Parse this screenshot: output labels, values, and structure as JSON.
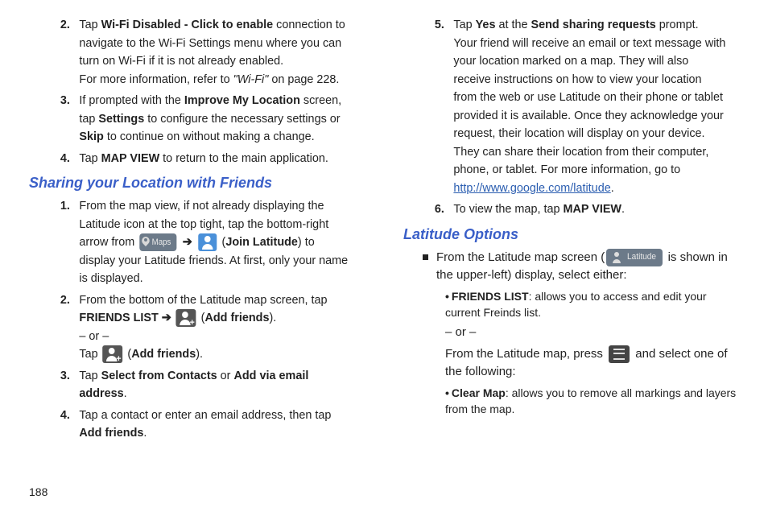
{
  "page_number": "188",
  "left": {
    "items_top": [
      {
        "num": "2.",
        "parts": [
          {
            "t": "Tap "
          },
          {
            "t": "Wi-Fi Disabled - Click to enable",
            "b": true
          },
          {
            "t": " connection to navigate to the Wi-Fi Settings menu where you can turn on Wi-Fi if it is not already enabled."
          },
          {
            "br": true
          },
          {
            "t": "For more information, refer to "
          },
          {
            "t": "\"Wi-Fi\"",
            "i": true
          },
          {
            "t": "  on page 228."
          }
        ]
      },
      {
        "num": "3.",
        "parts": [
          {
            "t": "If prompted with the "
          },
          {
            "t": "Improve My Location",
            "b": true
          },
          {
            "t": " screen, tap "
          },
          {
            "t": "Settings",
            "b": true
          },
          {
            "t": " to configure the necessary settings or "
          },
          {
            "t": "Skip",
            "b": true
          },
          {
            "t": " to continue on without making a change."
          }
        ]
      },
      {
        "num": "4.",
        "parts": [
          {
            "t": "Tap "
          },
          {
            "t": "MAP VIEW",
            "b": true
          },
          {
            "t": " to return to the main application."
          }
        ]
      }
    ],
    "heading1": "Sharing your Location with Friends",
    "items_share": [
      {
        "num": "1.",
        "parts": [
          {
            "t": "From the map view, if not already displaying the Latitude icon at the top tight, tap the bottom-right arrow from "
          },
          {
            "badge": "maps"
          },
          {
            "arrow": true
          },
          {
            "laticon": true
          },
          {
            "t": " ("
          },
          {
            "t": "Join Latitude",
            "b": true
          },
          {
            "t": ") to display your Latitude friends. At first, only your name is displayed."
          }
        ]
      },
      {
        "num": "2.",
        "parts": [
          {
            "t": "From the bottom of the Latitude map screen, tap "
          },
          {
            "t": "FRIENDS LIST ➔ ",
            "b": true
          },
          {
            "addf": true
          },
          {
            "t": " ("
          },
          {
            "t": "Add friends",
            "b": true
          },
          {
            "t": ")."
          },
          {
            "br": true
          },
          {
            "t": "– or –"
          },
          {
            "br": true
          },
          {
            "t": "Tap "
          },
          {
            "addf": true
          },
          {
            "t": " ("
          },
          {
            "t": "Add friends",
            "b": true
          },
          {
            "t": ")."
          }
        ]
      },
      {
        "num": "3.",
        "parts": [
          {
            "t": "Tap "
          },
          {
            "t": "Select from Contacts",
            "b": true
          },
          {
            "t": " or "
          },
          {
            "t": "Add via email address",
            "b": true
          },
          {
            "t": "."
          }
        ]
      },
      {
        "num": "4.",
        "parts": [
          {
            "t": "Tap a contact or enter an email address, then tap "
          },
          {
            "t": "Add friends",
            "b": true
          },
          {
            "t": "."
          }
        ]
      }
    ],
    "badge_maps_label": "Maps"
  },
  "right": {
    "items_top": [
      {
        "num": "5.",
        "parts": [
          {
            "t": "Tap "
          },
          {
            "t": "Yes",
            "b": true
          },
          {
            "t": " at the "
          },
          {
            "t": "Send sharing requests",
            "b": true
          },
          {
            "t": " prompt."
          },
          {
            "br": true
          },
          {
            "t": "Your friend will receive an email or text message with your location marked on a map. They will also receive instructions on how to view your location from the web or use Latitude on their phone or tablet provided it is available. Once they acknowledge your request, their location will display on your device. They can share their location from their computer, phone, or tablet. For more information, go to "
          },
          {
            "t": "http://www.google.com/latitude",
            "link": true
          },
          {
            "t": "."
          }
        ]
      },
      {
        "num": "6.",
        "parts": [
          {
            "t": "To view the map, tap "
          },
          {
            "t": "MAP VIEW",
            "b": true
          },
          {
            "t": "."
          }
        ]
      }
    ],
    "heading2": "Latitude Options",
    "lat_intro_pre": "From the Latitude map screen (",
    "lat_intro_post": " is shown in the upper-left) display, select either:",
    "badge_lat_label": "Latitude",
    "sub1_pre": "FRIENDS LIST",
    "sub1_post": ": allows you to access and edit your current Freinds list.",
    "or": "– or –",
    "press_pre": "From the Latitude map, press ",
    "press_post": " and select one of the following:",
    "sub2_pre": "Clear Map",
    "sub2_post": ": allows you to remove all markings and layers from the map."
  }
}
